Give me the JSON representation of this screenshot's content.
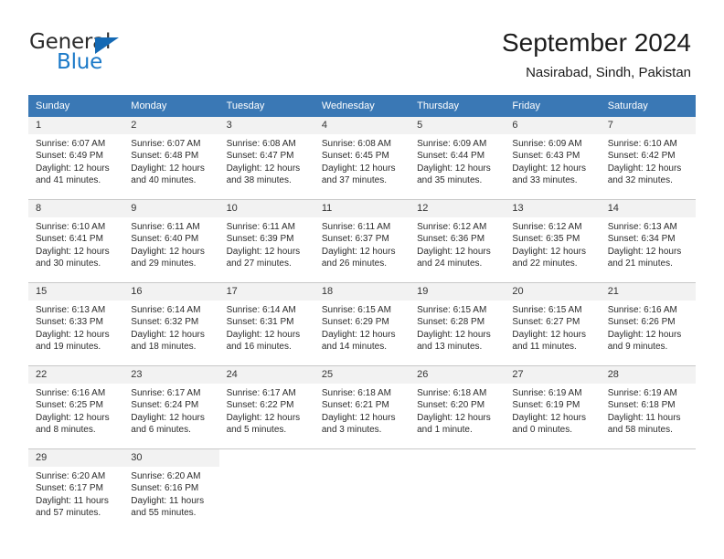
{
  "logo": {
    "word_top": "General",
    "word_bottom": "Blue",
    "triangle_color": "#1469b4",
    "blue_color": "#1b79c8"
  },
  "header": {
    "title": "September 2024",
    "subtitle": "Nasirabad, Sindh, Pakistan"
  },
  "theme": {
    "header_bg": "#3a78b5",
    "daynum_bg": "#f2f2f2",
    "grid_line": "#c8c8c8",
    "text": "#2b2b2b"
  },
  "weekdays": [
    "Sunday",
    "Monday",
    "Tuesday",
    "Wednesday",
    "Thursday",
    "Friday",
    "Saturday"
  ],
  "weeks": [
    [
      {
        "day": "1",
        "sunrise": "Sunrise: 6:07 AM",
        "sunset": "Sunset: 6:49 PM",
        "daylight1": "Daylight: 12 hours",
        "daylight2": "and 41 minutes."
      },
      {
        "day": "2",
        "sunrise": "Sunrise: 6:07 AM",
        "sunset": "Sunset: 6:48 PM",
        "daylight1": "Daylight: 12 hours",
        "daylight2": "and 40 minutes."
      },
      {
        "day": "3",
        "sunrise": "Sunrise: 6:08 AM",
        "sunset": "Sunset: 6:47 PM",
        "daylight1": "Daylight: 12 hours",
        "daylight2": "and 38 minutes."
      },
      {
        "day": "4",
        "sunrise": "Sunrise: 6:08 AM",
        "sunset": "Sunset: 6:45 PM",
        "daylight1": "Daylight: 12 hours",
        "daylight2": "and 37 minutes."
      },
      {
        "day": "5",
        "sunrise": "Sunrise: 6:09 AM",
        "sunset": "Sunset: 6:44 PM",
        "daylight1": "Daylight: 12 hours",
        "daylight2": "and 35 minutes."
      },
      {
        "day": "6",
        "sunrise": "Sunrise: 6:09 AM",
        "sunset": "Sunset: 6:43 PM",
        "daylight1": "Daylight: 12 hours",
        "daylight2": "and 33 minutes."
      },
      {
        "day": "7",
        "sunrise": "Sunrise: 6:10 AM",
        "sunset": "Sunset: 6:42 PM",
        "daylight1": "Daylight: 12 hours",
        "daylight2": "and 32 minutes."
      }
    ],
    [
      {
        "day": "8",
        "sunrise": "Sunrise: 6:10 AM",
        "sunset": "Sunset: 6:41 PM",
        "daylight1": "Daylight: 12 hours",
        "daylight2": "and 30 minutes."
      },
      {
        "day": "9",
        "sunrise": "Sunrise: 6:11 AM",
        "sunset": "Sunset: 6:40 PM",
        "daylight1": "Daylight: 12 hours",
        "daylight2": "and 29 minutes."
      },
      {
        "day": "10",
        "sunrise": "Sunrise: 6:11 AM",
        "sunset": "Sunset: 6:39 PM",
        "daylight1": "Daylight: 12 hours",
        "daylight2": "and 27 minutes."
      },
      {
        "day": "11",
        "sunrise": "Sunrise: 6:11 AM",
        "sunset": "Sunset: 6:37 PM",
        "daylight1": "Daylight: 12 hours",
        "daylight2": "and 26 minutes."
      },
      {
        "day": "12",
        "sunrise": "Sunrise: 6:12 AM",
        "sunset": "Sunset: 6:36 PM",
        "daylight1": "Daylight: 12 hours",
        "daylight2": "and 24 minutes."
      },
      {
        "day": "13",
        "sunrise": "Sunrise: 6:12 AM",
        "sunset": "Sunset: 6:35 PM",
        "daylight1": "Daylight: 12 hours",
        "daylight2": "and 22 minutes."
      },
      {
        "day": "14",
        "sunrise": "Sunrise: 6:13 AM",
        "sunset": "Sunset: 6:34 PM",
        "daylight1": "Daylight: 12 hours",
        "daylight2": "and 21 minutes."
      }
    ],
    [
      {
        "day": "15",
        "sunrise": "Sunrise: 6:13 AM",
        "sunset": "Sunset: 6:33 PM",
        "daylight1": "Daylight: 12 hours",
        "daylight2": "and 19 minutes."
      },
      {
        "day": "16",
        "sunrise": "Sunrise: 6:14 AM",
        "sunset": "Sunset: 6:32 PM",
        "daylight1": "Daylight: 12 hours",
        "daylight2": "and 18 minutes."
      },
      {
        "day": "17",
        "sunrise": "Sunrise: 6:14 AM",
        "sunset": "Sunset: 6:31 PM",
        "daylight1": "Daylight: 12 hours",
        "daylight2": "and 16 minutes."
      },
      {
        "day": "18",
        "sunrise": "Sunrise: 6:15 AM",
        "sunset": "Sunset: 6:29 PM",
        "daylight1": "Daylight: 12 hours",
        "daylight2": "and 14 minutes."
      },
      {
        "day": "19",
        "sunrise": "Sunrise: 6:15 AM",
        "sunset": "Sunset: 6:28 PM",
        "daylight1": "Daylight: 12 hours",
        "daylight2": "and 13 minutes."
      },
      {
        "day": "20",
        "sunrise": "Sunrise: 6:15 AM",
        "sunset": "Sunset: 6:27 PM",
        "daylight1": "Daylight: 12 hours",
        "daylight2": "and 11 minutes."
      },
      {
        "day": "21",
        "sunrise": "Sunrise: 6:16 AM",
        "sunset": "Sunset: 6:26 PM",
        "daylight1": "Daylight: 12 hours",
        "daylight2": "and 9 minutes."
      }
    ],
    [
      {
        "day": "22",
        "sunrise": "Sunrise: 6:16 AM",
        "sunset": "Sunset: 6:25 PM",
        "daylight1": "Daylight: 12 hours",
        "daylight2": "and 8 minutes."
      },
      {
        "day": "23",
        "sunrise": "Sunrise: 6:17 AM",
        "sunset": "Sunset: 6:24 PM",
        "daylight1": "Daylight: 12 hours",
        "daylight2": "and 6 minutes."
      },
      {
        "day": "24",
        "sunrise": "Sunrise: 6:17 AM",
        "sunset": "Sunset: 6:22 PM",
        "daylight1": "Daylight: 12 hours",
        "daylight2": "and 5 minutes."
      },
      {
        "day": "25",
        "sunrise": "Sunrise: 6:18 AM",
        "sunset": "Sunset: 6:21 PM",
        "daylight1": "Daylight: 12 hours",
        "daylight2": "and 3 minutes."
      },
      {
        "day": "26",
        "sunrise": "Sunrise: 6:18 AM",
        "sunset": "Sunset: 6:20 PM",
        "daylight1": "Daylight: 12 hours",
        "daylight2": "and 1 minute."
      },
      {
        "day": "27",
        "sunrise": "Sunrise: 6:19 AM",
        "sunset": "Sunset: 6:19 PM",
        "daylight1": "Daylight: 12 hours",
        "daylight2": "and 0 minutes."
      },
      {
        "day": "28",
        "sunrise": "Sunrise: 6:19 AM",
        "sunset": "Sunset: 6:18 PM",
        "daylight1": "Daylight: 11 hours",
        "daylight2": "and 58 minutes."
      }
    ],
    [
      {
        "day": "29",
        "sunrise": "Sunrise: 6:20 AM",
        "sunset": "Sunset: 6:17 PM",
        "daylight1": "Daylight: 11 hours",
        "daylight2": "and 57 minutes."
      },
      {
        "day": "30",
        "sunrise": "Sunrise: 6:20 AM",
        "sunset": "Sunset: 6:16 PM",
        "daylight1": "Daylight: 11 hours",
        "daylight2": "and 55 minutes."
      },
      {
        "day": "",
        "sunrise": "",
        "sunset": "",
        "daylight1": "",
        "daylight2": ""
      },
      {
        "day": "",
        "sunrise": "",
        "sunset": "",
        "daylight1": "",
        "daylight2": ""
      },
      {
        "day": "",
        "sunrise": "",
        "sunset": "",
        "daylight1": "",
        "daylight2": ""
      },
      {
        "day": "",
        "sunrise": "",
        "sunset": "",
        "daylight1": "",
        "daylight2": ""
      },
      {
        "day": "",
        "sunrise": "",
        "sunset": "",
        "daylight1": "",
        "daylight2": ""
      }
    ]
  ]
}
